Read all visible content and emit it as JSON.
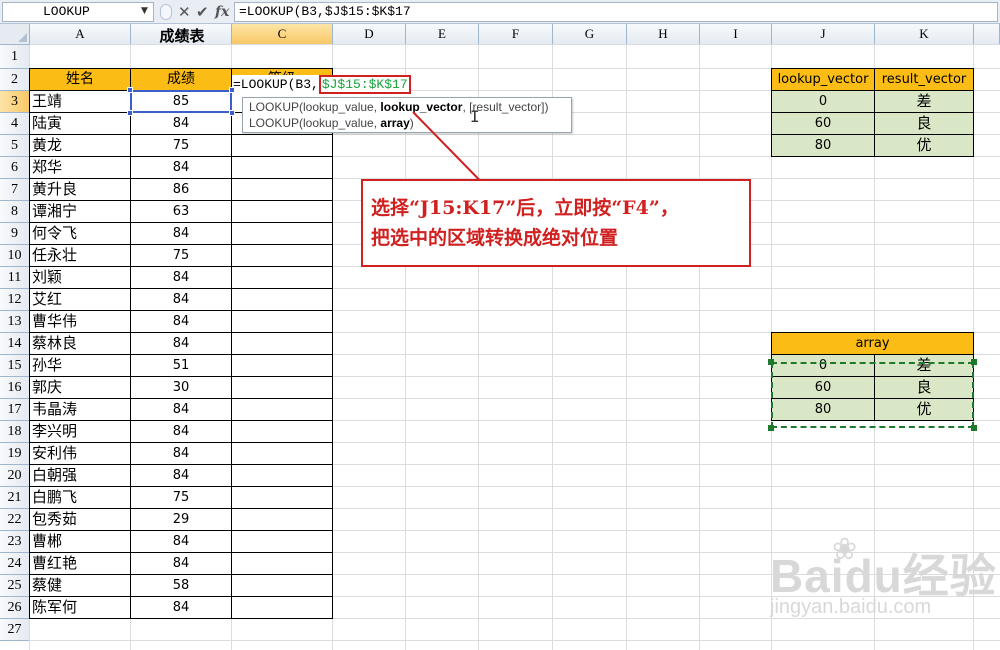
{
  "formula_bar": {
    "name_box": "LOOKUP",
    "cancel_icon": "✕",
    "enter_icon": "✔",
    "fx_icon": "fx",
    "formula": "=LOOKUP(B3,$J$15:$K$17"
  },
  "columns": [
    "A",
    "B",
    "C",
    "D",
    "E",
    "F",
    "G",
    "H",
    "I",
    "J",
    "K"
  ],
  "active_column": "C",
  "rows": [
    "1",
    "2",
    "3",
    "4",
    "5",
    "6",
    "7",
    "8",
    "9",
    "10",
    "11",
    "12",
    "13",
    "14",
    "15",
    "16",
    "17",
    "18",
    "19",
    "20",
    "21",
    "22",
    "23",
    "24",
    "25",
    "26",
    "27"
  ],
  "active_row": "3",
  "sheet": {
    "title": "成绩表",
    "headers": {
      "name": "姓名",
      "score": "成绩",
      "grade": "等级"
    },
    "students": [
      [
        "王靖",
        "85"
      ],
      [
        "陆寅",
        "84"
      ],
      [
        "黄龙",
        "75"
      ],
      [
        "郑华",
        "84"
      ],
      [
        "黄升良",
        "86"
      ],
      [
        "谭湘宁",
        "63"
      ],
      [
        "何令飞",
        "84"
      ],
      [
        "任永壮",
        "75"
      ],
      [
        "刘颖",
        "84"
      ],
      [
        "艾红",
        "84"
      ],
      [
        "曹华伟",
        "84"
      ],
      [
        "蔡林良",
        "84"
      ],
      [
        "孙华",
        "51"
      ],
      [
        "郭庆",
        "30"
      ],
      [
        "韦晶涛",
        "84"
      ],
      [
        "李兴明",
        "84"
      ],
      [
        "安利伟",
        "84"
      ],
      [
        "白朝强",
        "84"
      ],
      [
        "白鹏飞",
        "75"
      ],
      [
        "包秀茹",
        "29"
      ],
      [
        "曹郴",
        "84"
      ],
      [
        "曹红艳",
        "84"
      ],
      [
        "蔡健",
        "58"
      ],
      [
        "陈军何",
        "84"
      ]
    ]
  },
  "formula_cell": {
    "prefix": "=LOOKUP(B3,",
    "ref": "$J$15:$K$17"
  },
  "tooltip": {
    "line1_pre": "LOOKUP(lookup_value, ",
    "line1_bold": "lookup_vector",
    "line1_post": ", [result_vector])",
    "line2_pre": "LOOKUP(lookup_value, ",
    "line2_bold": "array",
    "line2_post": ")"
  },
  "vector_table": {
    "headers": [
      "lookup_vector",
      "result_vector"
    ],
    "rows": [
      [
        "0",
        "差"
      ],
      [
        "60",
        "良"
      ],
      [
        "80",
        "优"
      ]
    ]
  },
  "array_table": {
    "header": "array",
    "rows": [
      [
        "0",
        "差"
      ],
      [
        "60",
        "良"
      ],
      [
        "80",
        "优"
      ]
    ]
  },
  "callout": {
    "line1": "选择“J15:K17”后，立即按“F4”，",
    "line2": "把选中的区域转换成绝对位置"
  },
  "watermark": {
    "logo": "Baidu经验",
    "url": "jingyan.baidu.com"
  },
  "colors": {
    "header_orange": "#fbbd15",
    "table_green": "#d9e7c6",
    "callout_red": "#d02020",
    "ref_green": "#17a33b"
  }
}
